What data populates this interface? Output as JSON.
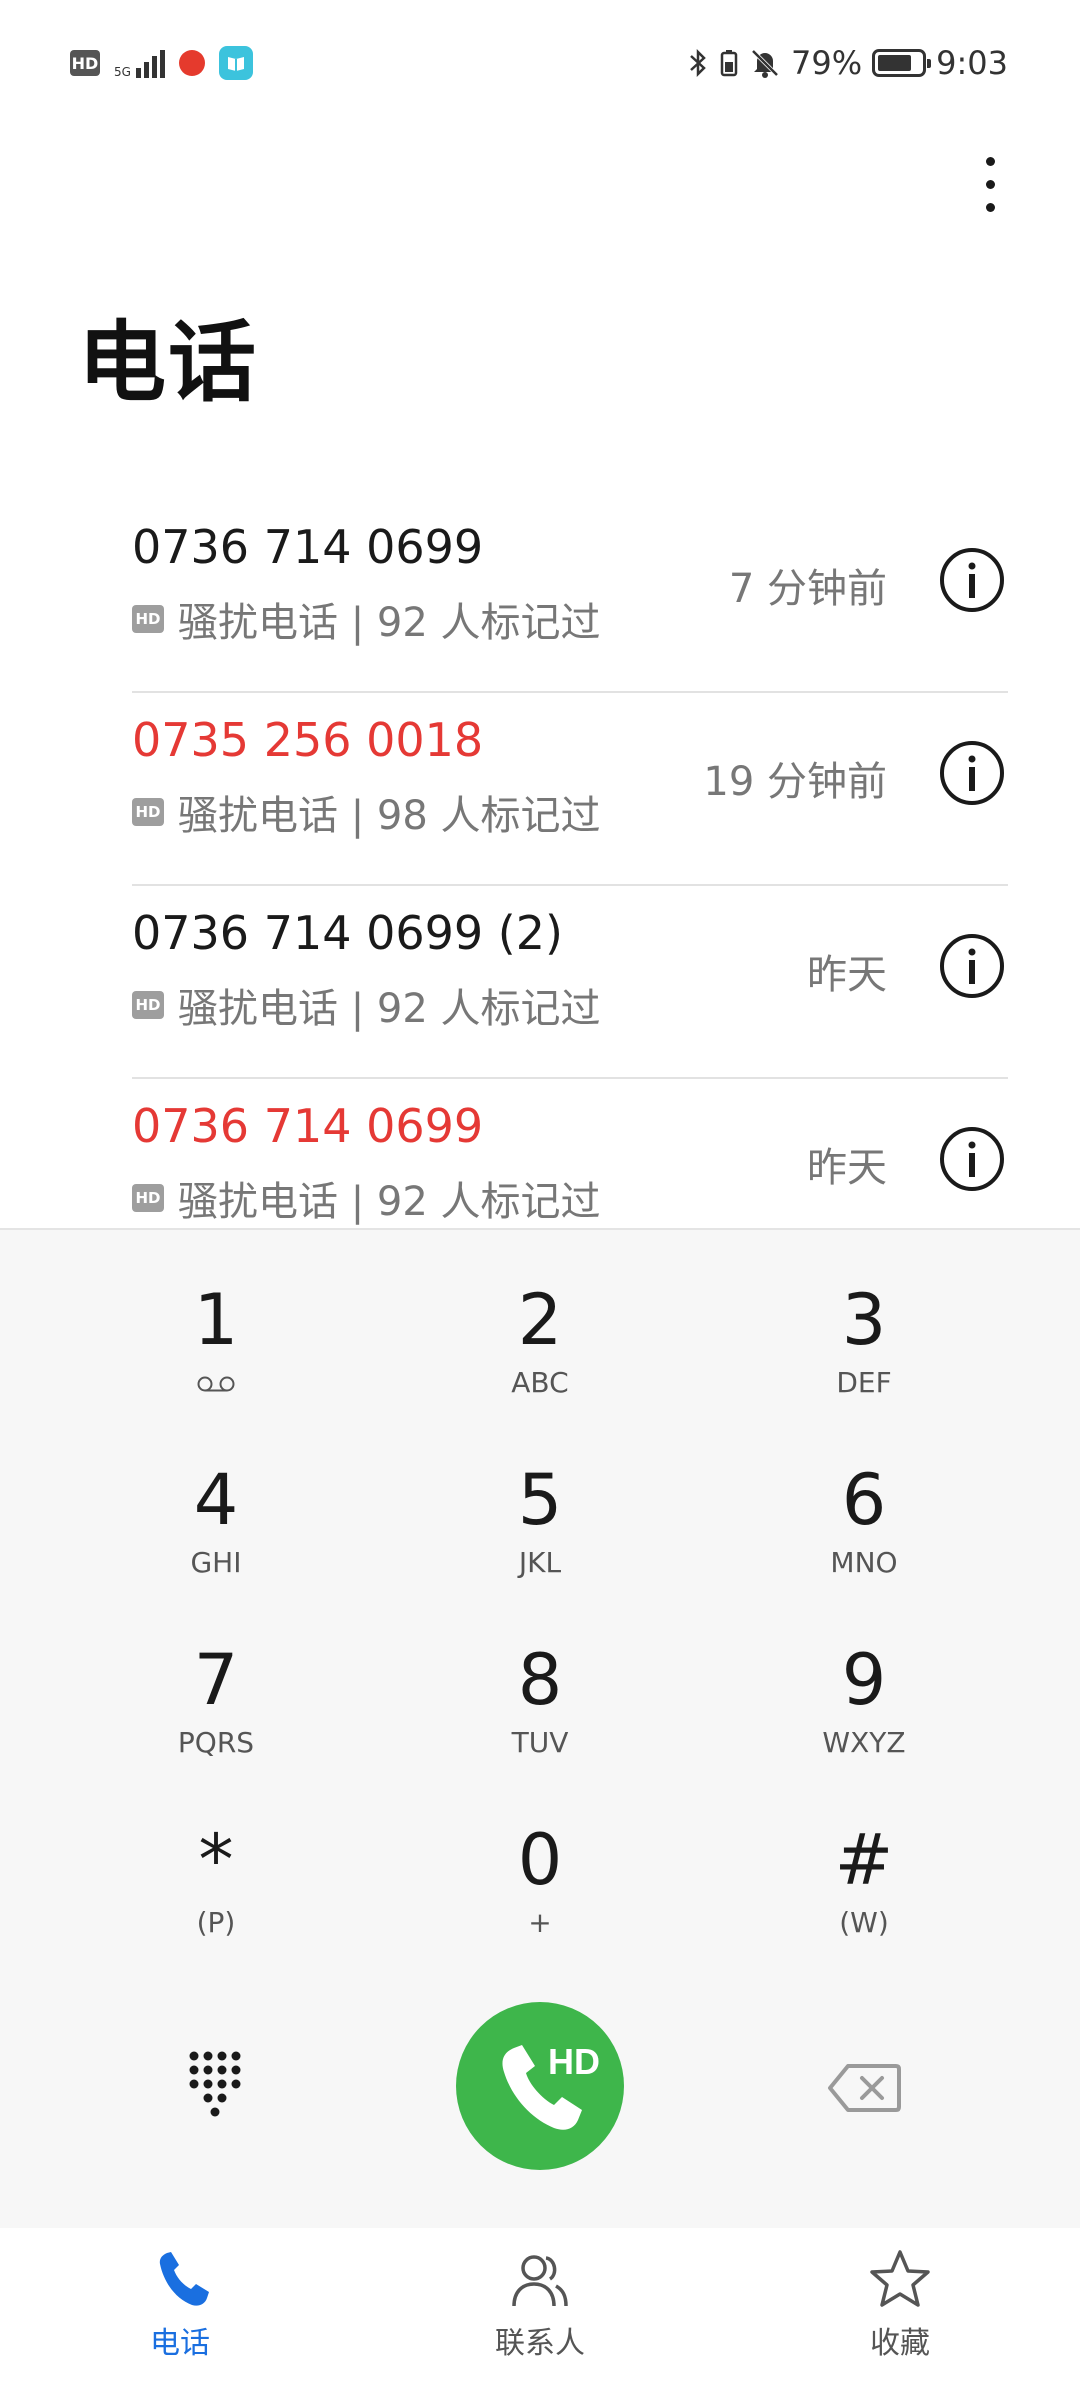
{
  "status_bar": {
    "hd": "HD",
    "network": "5G",
    "battery_percent": "79%",
    "battery_level": 0.79,
    "time": "9:03"
  },
  "page": {
    "title": "电话"
  },
  "call_log": [
    {
      "number": "0736 714 0699",
      "missed": false,
      "badge": "HD",
      "description": "骚扰电话 | 92 人标记过",
      "time": "7 分钟前"
    },
    {
      "number": "0735 256 0018",
      "missed": true,
      "badge": "HD",
      "description": "骚扰电话 | 98 人标记过",
      "time": "19 分钟前"
    },
    {
      "number": "0736 714 0699 (2)",
      "missed": false,
      "badge": "HD",
      "description": "骚扰电话 | 92 人标记过",
      "time": "昨天"
    },
    {
      "number": "0736 714 0699",
      "missed": true,
      "badge": "HD",
      "description": "骚扰电话 | 92 人标记过",
      "time": "昨天"
    }
  ],
  "dialpad": {
    "keys": [
      {
        "digit": "1",
        "letters": "",
        "icon": "voicemail-icon"
      },
      {
        "digit": "2",
        "letters": "ABC"
      },
      {
        "digit": "3",
        "letters": "DEF"
      },
      {
        "digit": "4",
        "letters": "GHI"
      },
      {
        "digit": "5",
        "letters": "JKL"
      },
      {
        "digit": "6",
        "letters": "MNO"
      },
      {
        "digit": "7",
        "letters": "PQRS"
      },
      {
        "digit": "8",
        "letters": "TUV"
      },
      {
        "digit": "9",
        "letters": "WXYZ"
      },
      {
        "digit": "*",
        "letters": "(P)"
      },
      {
        "digit": "0",
        "letters": "+"
      },
      {
        "digit": "#",
        "letters": "(W)"
      }
    ],
    "call_button_badge": "HD"
  },
  "bottom_nav": [
    {
      "label": "电话",
      "icon": "phone-icon",
      "active": true
    },
    {
      "label": "联系人",
      "icon": "contacts-icon",
      "active": false
    },
    {
      "label": "收藏",
      "icon": "star-icon",
      "active": false
    }
  ],
  "colors": {
    "missed": "#e53935",
    "accent": "#1a6fe0",
    "call_green": "#3eb64b",
    "dialpad_bg": "#f7f7f7"
  }
}
